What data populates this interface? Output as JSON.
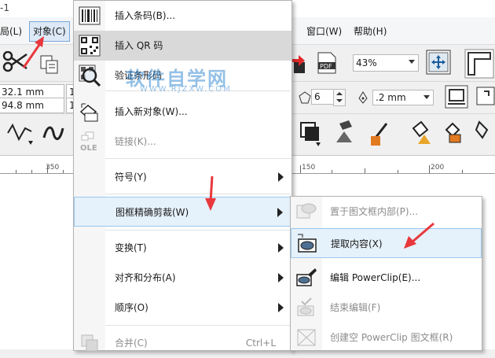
{
  "window": {
    "title_fragment": "-1"
  },
  "menubar": {
    "items": [
      {
        "label": "局(L)"
      },
      {
        "label": "对象(C)"
      },
      {
        "label": "窗口(W)"
      },
      {
        "label": "帮助(H)"
      }
    ]
  },
  "toolbar": {
    "zoom": "43%",
    "x_pos": "32.1 mm",
    "y_pos": "94.8 mm",
    "x_pos_suffix": "1",
    "y_pos_suffix": "1",
    "sides_value": "6",
    "outline_width": ".2 mm"
  },
  "ruler": {
    "ticks": [
      "350",
      "150",
      "200"
    ]
  },
  "watermark": {
    "text": "软件自学网",
    "sub": "WWW.RJZXW.COM"
  },
  "object_menu": {
    "items": [
      {
        "label": "插入条码(B)...",
        "icon": "barcode-icon"
      },
      {
        "label": "插入 QR 码",
        "icon": "qr-code-icon"
      },
      {
        "label": "验证条形码",
        "icon": "magnifier-qr-icon"
      },
      {
        "label": "插入新对象(W)...",
        "icon": "insert-object-icon"
      },
      {
        "label": "链接(K)...",
        "icon": "ole-icon",
        "icon_text": "OLE"
      },
      {
        "label": "符号(Y)"
      },
      {
        "label": "图框精确剪裁(W)"
      },
      {
        "label": "变换(T)"
      },
      {
        "label": "对齐和分布(A)"
      },
      {
        "label": "顺序(O)"
      },
      {
        "label": "合并(C)",
        "shortcut": "Ctrl+L",
        "icon": "combine-icon"
      }
    ]
  },
  "powerclip_submenu": {
    "items": [
      {
        "label": "置于图文框内部(P)...",
        "icon": "place-inside-frame-icon"
      },
      {
        "label": "提取内容(X)",
        "icon": "extract-contents-icon"
      },
      {
        "label": "编辑 PowerClip(E)...",
        "icon": "edit-powerclip-icon"
      },
      {
        "label": "结束编辑(F)",
        "icon": "finish-editing-icon"
      },
      {
        "label": "创建空 PowerClip 图文框(R)",
        "icon": "empty-frame-icon"
      }
    ]
  },
  "colors": {
    "accent_arrow": "#e8383d",
    "selection": "#e5f1fb",
    "selection_border": "#9ac7ee"
  }
}
